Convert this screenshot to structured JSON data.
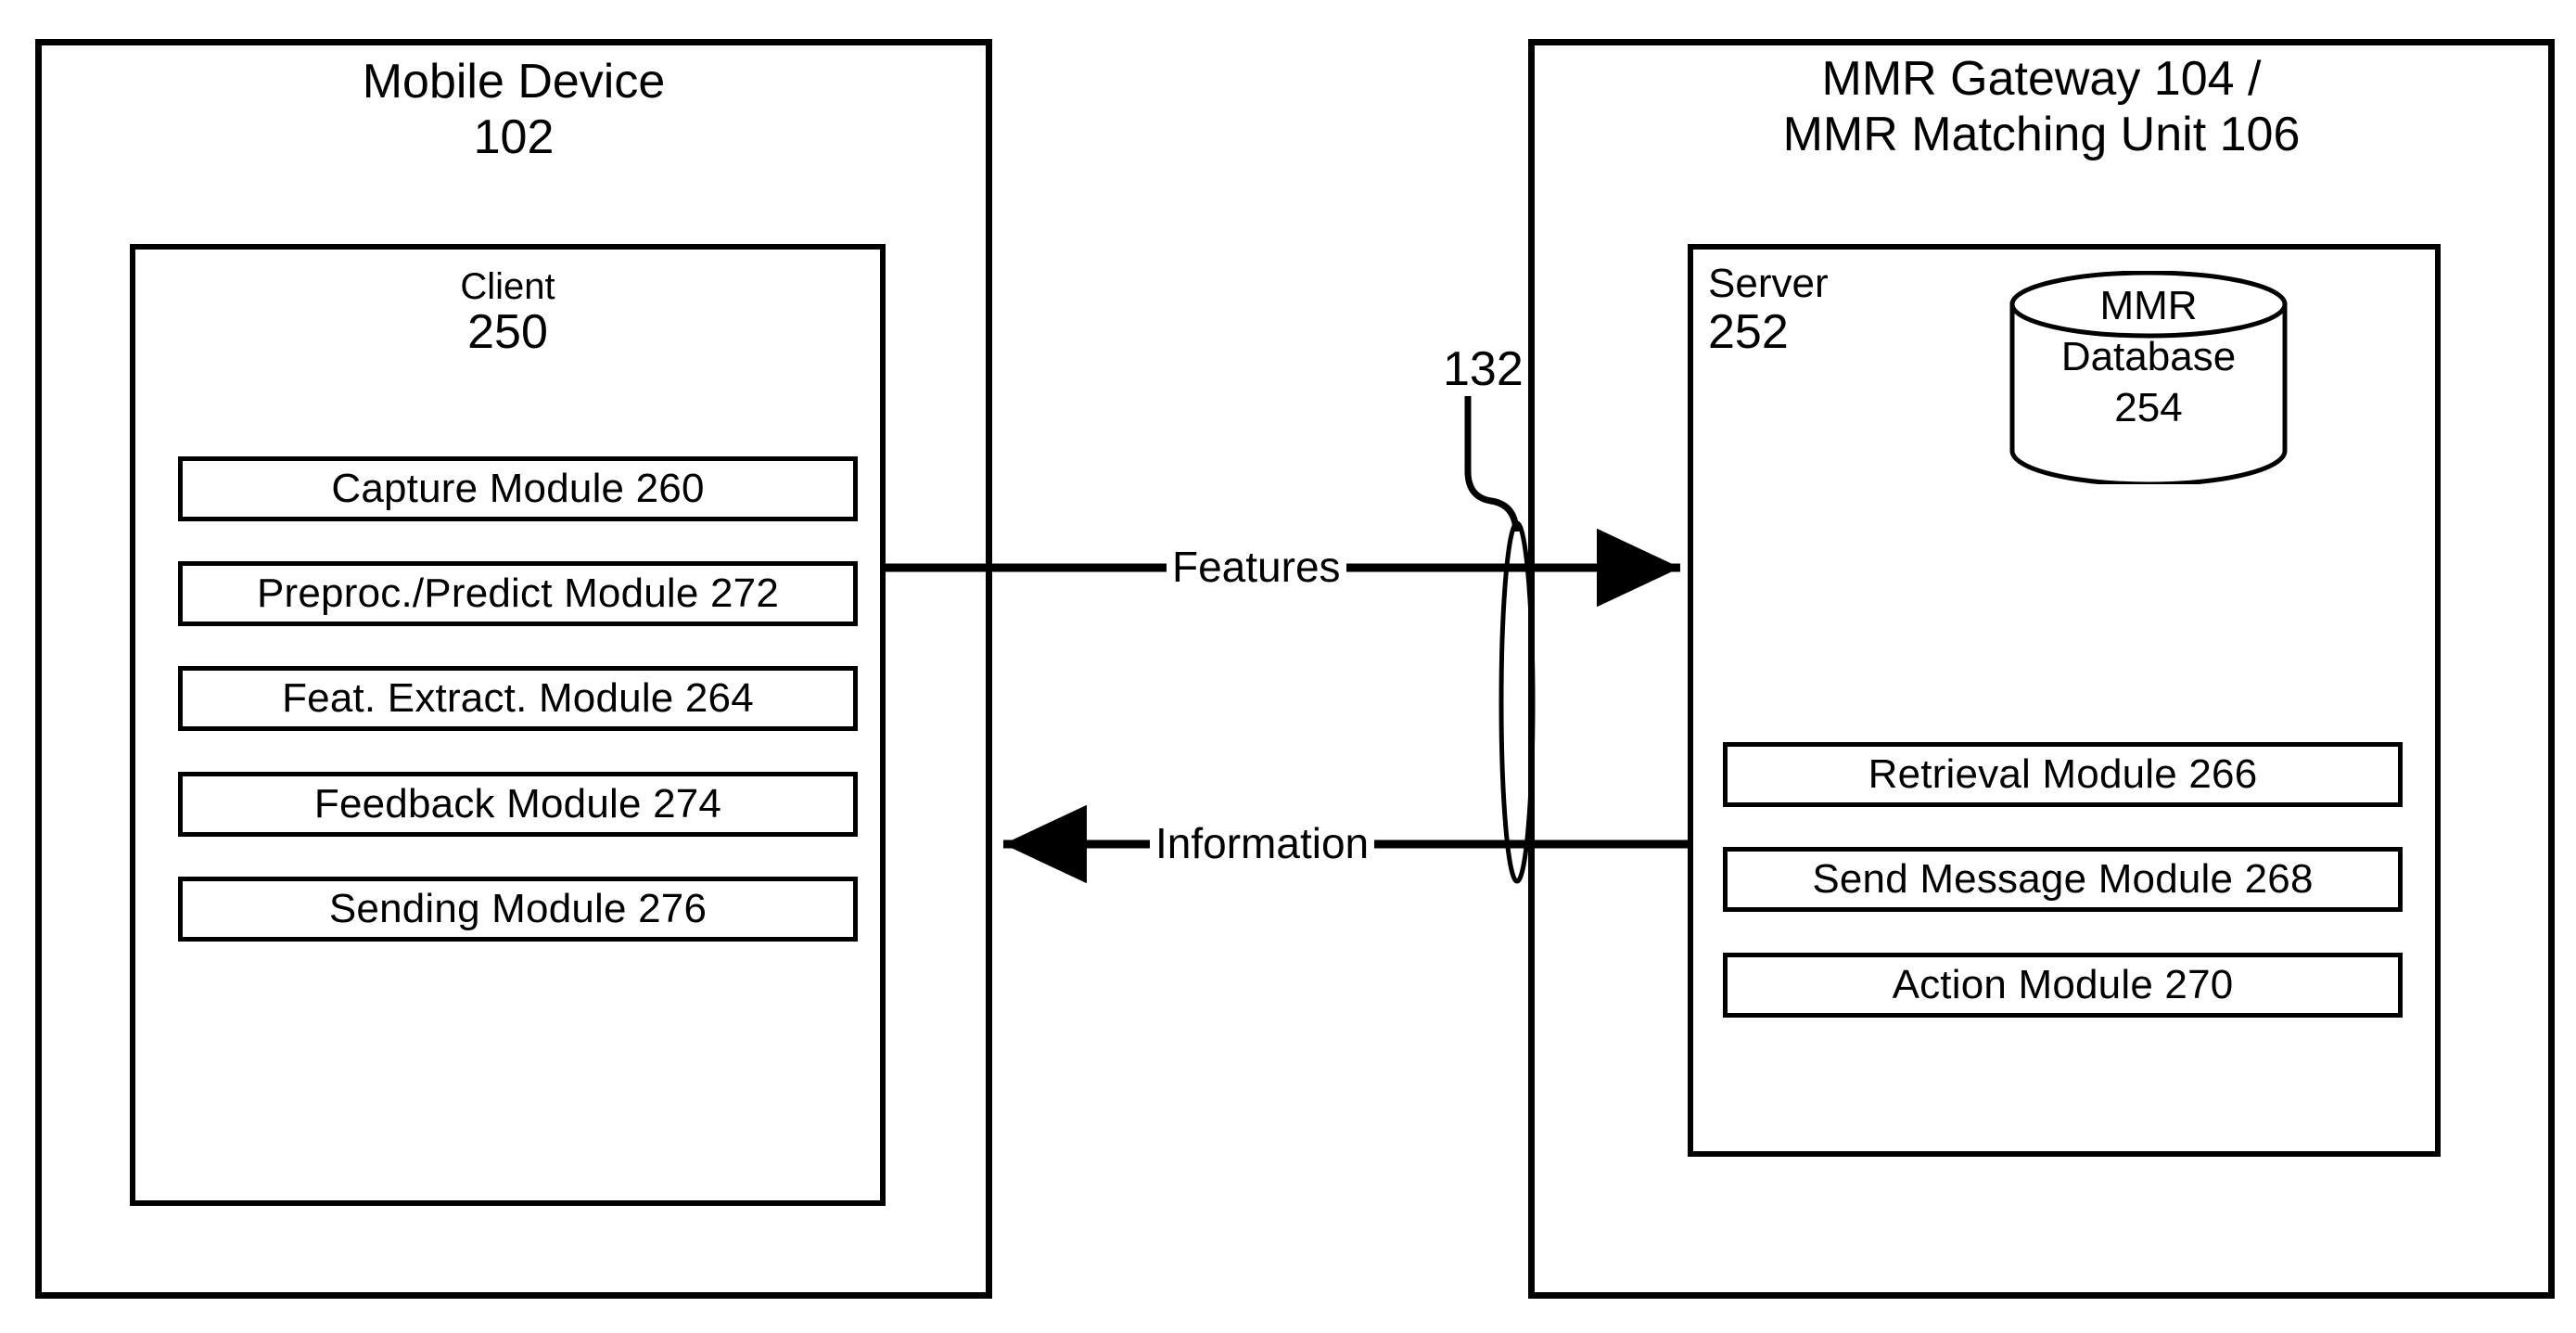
{
  "figure": {
    "left_panel": {
      "title": "Mobile Device\n102",
      "inner": {
        "name": "Client",
        "number": "250"
      },
      "modules": [
        {
          "label": "Capture Module 260"
        },
        {
          "label": "Preproc./Predict  Module 272"
        },
        {
          "label": "Feat. Extract. Module 264"
        },
        {
          "label": "Feedback  Module 274"
        },
        {
          "label": "Sending Module 276"
        }
      ]
    },
    "right_panel": {
      "title": "MMR Gateway 104 /\nMMR Matching Unit 106",
      "inner": {
        "name": "Server",
        "number": "252"
      },
      "database": {
        "label": "MMR\nDatabase\n254"
      },
      "modules": [
        {
          "label": "Retrieval Module 266"
        },
        {
          "label": "Send Message Module 268"
        },
        {
          "label": "Action  Module 270"
        }
      ]
    },
    "connectors": {
      "network_ref": "132",
      "features_label": "Features",
      "information_label": "Information"
    },
    "colors": {
      "stroke": "#000000",
      "background": "#ffffff"
    }
  }
}
